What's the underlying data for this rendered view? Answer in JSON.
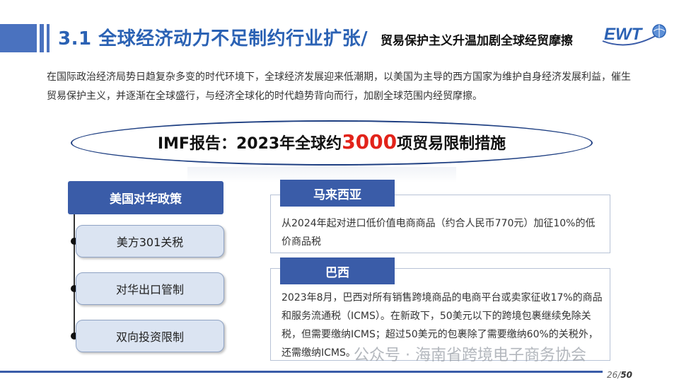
{
  "header": {
    "title_main": "3.1 全球经济动力不足制约行业扩张/",
    "title_sub": "贸易保护主义升温加剧全球经贸摩擦",
    "logo_text": "EWT"
  },
  "intro": "在国际政治经济局势日趋复杂多变的时代环境下，全球经济发展迎来低潮期，以美国为主导的西方国家为维护自身经济发展利益，催生贸易保护主义，并逐渐在全球盛行，与经济全球化的时代趋势背向而行，加剧全球范围内经贸摩擦。",
  "banner": {
    "prefix": "IMF报告：2023年全球约",
    "highlight": "3000",
    "suffix": "项贸易限制措施"
  },
  "us_policy": {
    "title": "美国对华政策",
    "items": [
      "美方301关税",
      "对华出口管制",
      "双向投资限制"
    ]
  },
  "countries": [
    {
      "name": "马来西亚",
      "text": "从2024年起对进口低价值电商商品（约合人民币770元）加征10%的低价商品税"
    },
    {
      "name": "巴西",
      "text": "2023年8月，巴西对所有销售跨境商品的电商平台或卖家征收17%的商品和服务流通税（ICMS）。在新政下，50美元以下的跨境包裹继续免除关税，但需要缴纳ICMS；超过50美元的包裹除了需要缴纳60%的关税外，还需缴纳ICMS。"
    }
  ],
  "watermark": "公众号 · 海南省跨境电子商务协会",
  "page": {
    "current": "26",
    "total": "50"
  },
  "colors": {
    "accent": "#3a5ca8",
    "title_blue": "#2b62b4",
    "highlight_red": "#e2231a"
  }
}
